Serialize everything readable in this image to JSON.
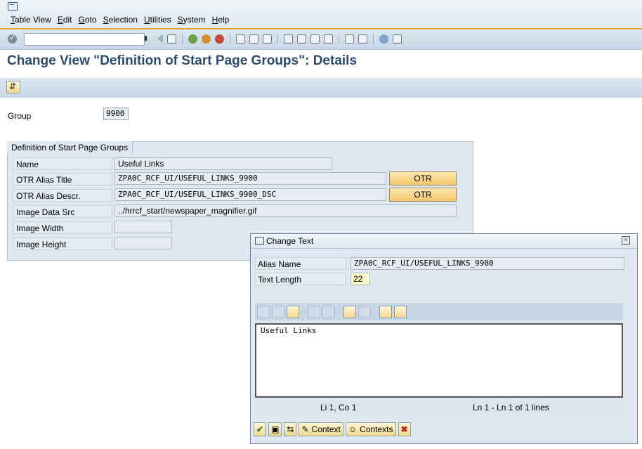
{
  "menubar": {
    "items": [
      "Table View",
      "Edit",
      "Goto",
      "Selection",
      "Utilities",
      "System",
      "Help"
    ]
  },
  "page": {
    "title": "Change View \"Definition of Start Page Groups\": Details"
  },
  "group": {
    "label": "Group",
    "value": "9900"
  },
  "frame": {
    "title": "Definition of Start Page Groups",
    "rows": [
      {
        "label": "Name",
        "value": "Useful Links"
      },
      {
        "label": "OTR Alias Title",
        "value": "ZPA0C_RCF_UI/USEFUL_LINKS_9900",
        "button": "OTR"
      },
      {
        "label": "OTR Alias Descr.",
        "value": "ZPA0C_RCF_UI/USEFUL_LINKS_9900_DSC",
        "button": "OTR"
      },
      {
        "label": "Image Data Src",
        "value": "../hrrcf_start/newspaper_magnifier.gif"
      },
      {
        "label": "Image Width",
        "value": ""
      },
      {
        "label": "Image Height",
        "value": ""
      }
    ]
  },
  "dialog": {
    "title": "Change Text",
    "alias_label": "Alias Name",
    "alias_value": "ZPA0C_RCF_UI/USEFUL_LINKS_9900",
    "length_label": "Text Length",
    "length_value": "22",
    "editor_text": "Useful Links",
    "status_pos": "Li 1, Co 1",
    "status_lines": "Ln 1 - Ln 1 of 1 lines",
    "footer": {
      "context_label": "Context",
      "contexts_label": "Contexts"
    }
  }
}
